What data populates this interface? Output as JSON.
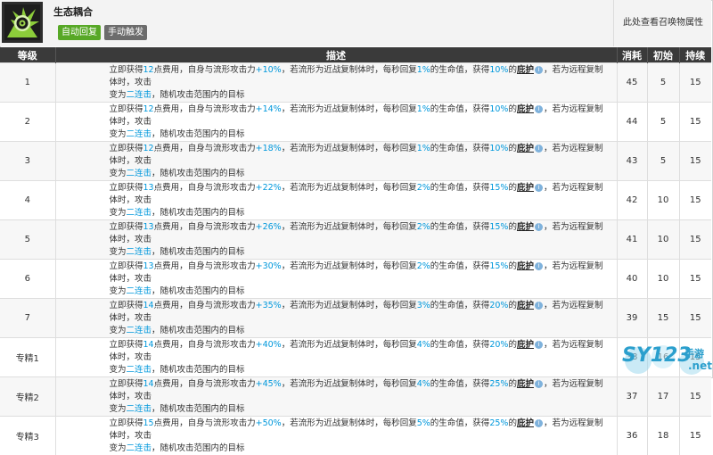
{
  "skill": {
    "name": "生态耦合",
    "tags": [
      "自动回复",
      "手动触发"
    ],
    "summon_link": "此处查看召唤物属性",
    "icon": "spiral-eye-skill-icon"
  },
  "table": {
    "headers": [
      "等级",
      "描述",
      "消耗",
      "初始",
      "持续"
    ],
    "text": {
      "p1": "立即获得",
      "p2": "点费用，自身与流形攻击力",
      "p3": "，若流形为近战复制体时，每秒回复",
      "p4": "的生命值，获得",
      "p5": "的",
      "kw": "庇护",
      "p6": "，若为远程复制体时，攻击",
      "p7": "变为",
      "p8": "二连击",
      "p9": "，随机攻击范围内的目标",
      "info": "i"
    },
    "rows": [
      {
        "level": "1",
        "cost_pts": "12",
        "atk": "+10%",
        "regen": "1%",
        "shield": "10%",
        "sp_cost": "45",
        "init": "5",
        "dur": "15"
      },
      {
        "level": "2",
        "cost_pts": "12",
        "atk": "+14%",
        "regen": "1%",
        "shield": "10%",
        "sp_cost": "44",
        "init": "5",
        "dur": "15"
      },
      {
        "level": "3",
        "cost_pts": "12",
        "atk": "+18%",
        "regen": "1%",
        "shield": "10%",
        "sp_cost": "43",
        "init": "5",
        "dur": "15"
      },
      {
        "level": "4",
        "cost_pts": "13",
        "atk": "+22%",
        "regen": "2%",
        "shield": "15%",
        "sp_cost": "42",
        "init": "10",
        "dur": "15"
      },
      {
        "level": "5",
        "cost_pts": "13",
        "atk": "+26%",
        "regen": "2%",
        "shield": "15%",
        "sp_cost": "41",
        "init": "10",
        "dur": "15"
      },
      {
        "level": "6",
        "cost_pts": "13",
        "atk": "+30%",
        "regen": "2%",
        "shield": "15%",
        "sp_cost": "40",
        "init": "10",
        "dur": "15"
      },
      {
        "level": "7",
        "cost_pts": "14",
        "atk": "+35%",
        "regen": "3%",
        "shield": "20%",
        "sp_cost": "39",
        "init": "15",
        "dur": "15"
      },
      {
        "level": "专精1",
        "cost_pts": "14",
        "atk": "+40%",
        "regen": "4%",
        "shield": "20%",
        "sp_cost": "38",
        "init": "16",
        "dur": "15"
      },
      {
        "level": "专精2",
        "cost_pts": "14",
        "atk": "+45%",
        "regen": "4%",
        "shield": "25%",
        "sp_cost": "37",
        "init": "17",
        "dur": "15"
      },
      {
        "level": "专精3",
        "cost_pts": "15",
        "atk": "+50%",
        "regen": "5%",
        "shield": "25%",
        "sp_cost": "36",
        "init": "18",
        "dur": "15"
      }
    ]
  },
  "watermark": {
    "brand": "SY123",
    "suffix": ".net",
    "tag": "手游"
  }
}
